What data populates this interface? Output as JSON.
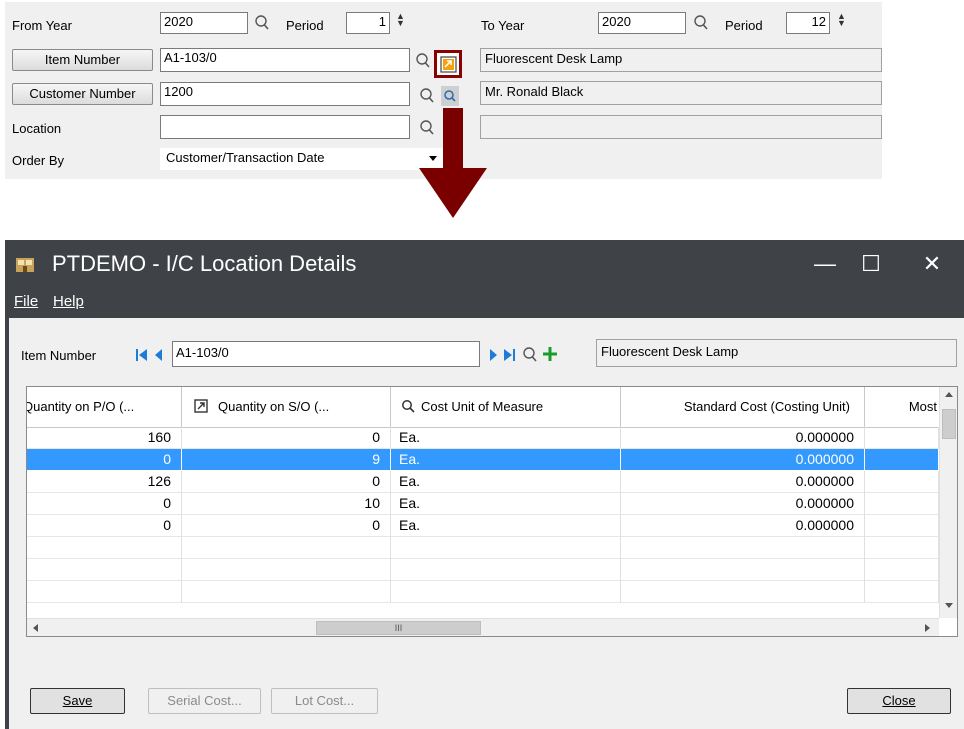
{
  "top_form": {
    "from_year_label": "From Year",
    "from_year_value": "2020",
    "period_label": "Period",
    "from_period_value": "1",
    "to_year_label": "To Year",
    "to_year_value": "2020",
    "to_period_label": "Period",
    "to_period_value": "12",
    "item_number_button": "Item Number",
    "item_number_value": "A1-103/0",
    "item_description": "Fluorescent Desk Lamp",
    "customer_number_button": "Customer Number",
    "customer_number_value": "1200",
    "customer_name": "Mr. Ronald Black",
    "location_label": "Location",
    "location_value": "",
    "location_description": "",
    "order_by_label": "Order By",
    "order_by_value": "Customer/Transaction Date"
  },
  "window": {
    "title": "PTDEMO - I/C Location Details",
    "controls": {
      "minimize": "—",
      "maximize": "☐",
      "close": "✕"
    },
    "menu": [
      "File",
      "Help"
    ],
    "item_number_label": "Item Number",
    "item_number_value": "A1-103/0",
    "item_description": "Fluorescent Desk Lamp",
    "grid": {
      "columns": [
        "Quantity on P/O (...",
        "Quantity on S/O (...",
        "Cost Unit of Measure",
        "Standard Cost (Costing Unit)",
        "Most"
      ],
      "rows": [
        [
          "160",
          "0",
          "Ea.",
          "0.000000"
        ],
        [
          "0",
          "9",
          "Ea.",
          "0.000000"
        ],
        [
          "126",
          "0",
          "Ea.",
          "0.000000"
        ],
        [
          "0",
          "10",
          "Ea.",
          "0.000000"
        ],
        [
          "0",
          "0",
          "Ea.",
          "0.000000"
        ]
      ],
      "selected_row": 1,
      "hscroll_grip": "III"
    },
    "buttons": {
      "save": "Save",
      "serial_cost": "Serial Cost...",
      "lot_cost": "Lot Cost...",
      "close": "Close"
    }
  },
  "colors": {
    "highlight": "#8b0000",
    "selection": "#3399ff",
    "titlebar": "#3f4347",
    "add_icon": "#1a9c2b",
    "nav_arrow": "#1f7bd8"
  }
}
